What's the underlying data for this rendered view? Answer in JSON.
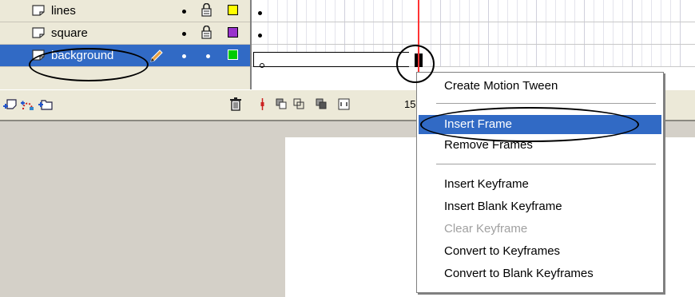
{
  "layers": [
    {
      "name": "lines",
      "color": "#ffff00",
      "selected": false
    },
    {
      "name": "square",
      "color": "#9933cc",
      "selected": false
    },
    {
      "name": "background",
      "color": "#00cc00",
      "selected": true
    }
  ],
  "timeline": {
    "frame_number": "15"
  },
  "context_menu": {
    "items": [
      {
        "label": "Create Motion Tween",
        "state": "normal"
      },
      {
        "label": "Insert Frame",
        "state": "highlighted"
      },
      {
        "label": "Remove Frames",
        "state": "normal"
      },
      {
        "label": "Insert Keyframe",
        "state": "normal"
      },
      {
        "label": "Insert Blank Keyframe",
        "state": "normal"
      },
      {
        "label": "Clear Keyframe",
        "state": "disabled"
      },
      {
        "label": "Convert to Keyframes",
        "state": "normal"
      },
      {
        "label": "Convert to Blank Keyframes",
        "state": "normal"
      }
    ]
  },
  "icons": {
    "layer": "layer-page-icon",
    "lock": "lock-icon",
    "pencil": "pencil-icon",
    "insert_layer": "insert-layer-icon",
    "add_guide": "add-motion-guide-icon",
    "insert_folder": "insert-folder-icon",
    "trash": "trash-icon"
  },
  "colors": {
    "selection": "#316ac5",
    "playhead": "#ff3333"
  }
}
